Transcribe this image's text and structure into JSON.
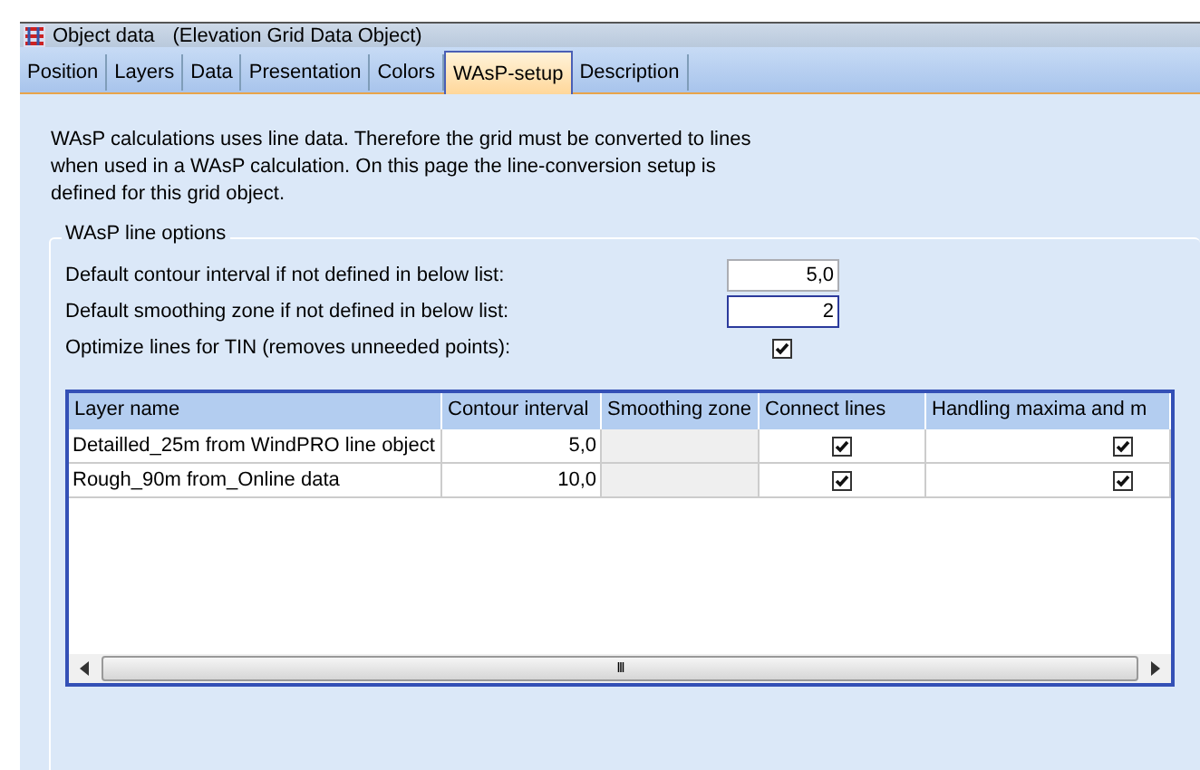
{
  "window": {
    "title": "Object data",
    "subtitle": "(Elevation Grid Data Object)"
  },
  "tabs": [
    {
      "label": "Position",
      "selected": false
    },
    {
      "label": "Layers",
      "selected": false
    },
    {
      "label": "Data",
      "selected": false
    },
    {
      "label": "Presentation",
      "selected": false
    },
    {
      "label": "Colors",
      "selected": false
    },
    {
      "label": "WAsP-setup",
      "selected": true
    },
    {
      "label": "Description",
      "selected": false
    }
  ],
  "description": "WAsP calculations uses line data. Therefore the grid must be converted to lines when used in a WAsP calculation. On this page the line-conversion setup is defined for this grid object.",
  "group": {
    "title": "WAsP line options",
    "options": [
      {
        "kind": "field",
        "label": "Default contour interval if not defined in below list:",
        "value": "5,0",
        "focused": false
      },
      {
        "kind": "field",
        "label": "Default smoothing zone if not defined in below list:",
        "value": "2",
        "focused": true
      },
      {
        "kind": "checkbox",
        "label": "Optimize lines for TIN (removes unneeded points):",
        "checked": true
      }
    ]
  },
  "table": {
    "columns": [
      "Layer name",
      "Contour interval",
      "Smoothing zone",
      "Connect lines",
      "Handling maxima and m"
    ],
    "rows": [
      {
        "layer_name": "Detailled_25m from WindPRO line object",
        "contour_interval": "5,0",
        "connect_lines": true,
        "handling_maxima": true
      },
      {
        "layer_name": "Rough_90m from_Online data",
        "contour_interval": "10,0",
        "connect_lines": true,
        "handling_maxima": true
      }
    ],
    "scrollbar_grip": "III"
  }
}
